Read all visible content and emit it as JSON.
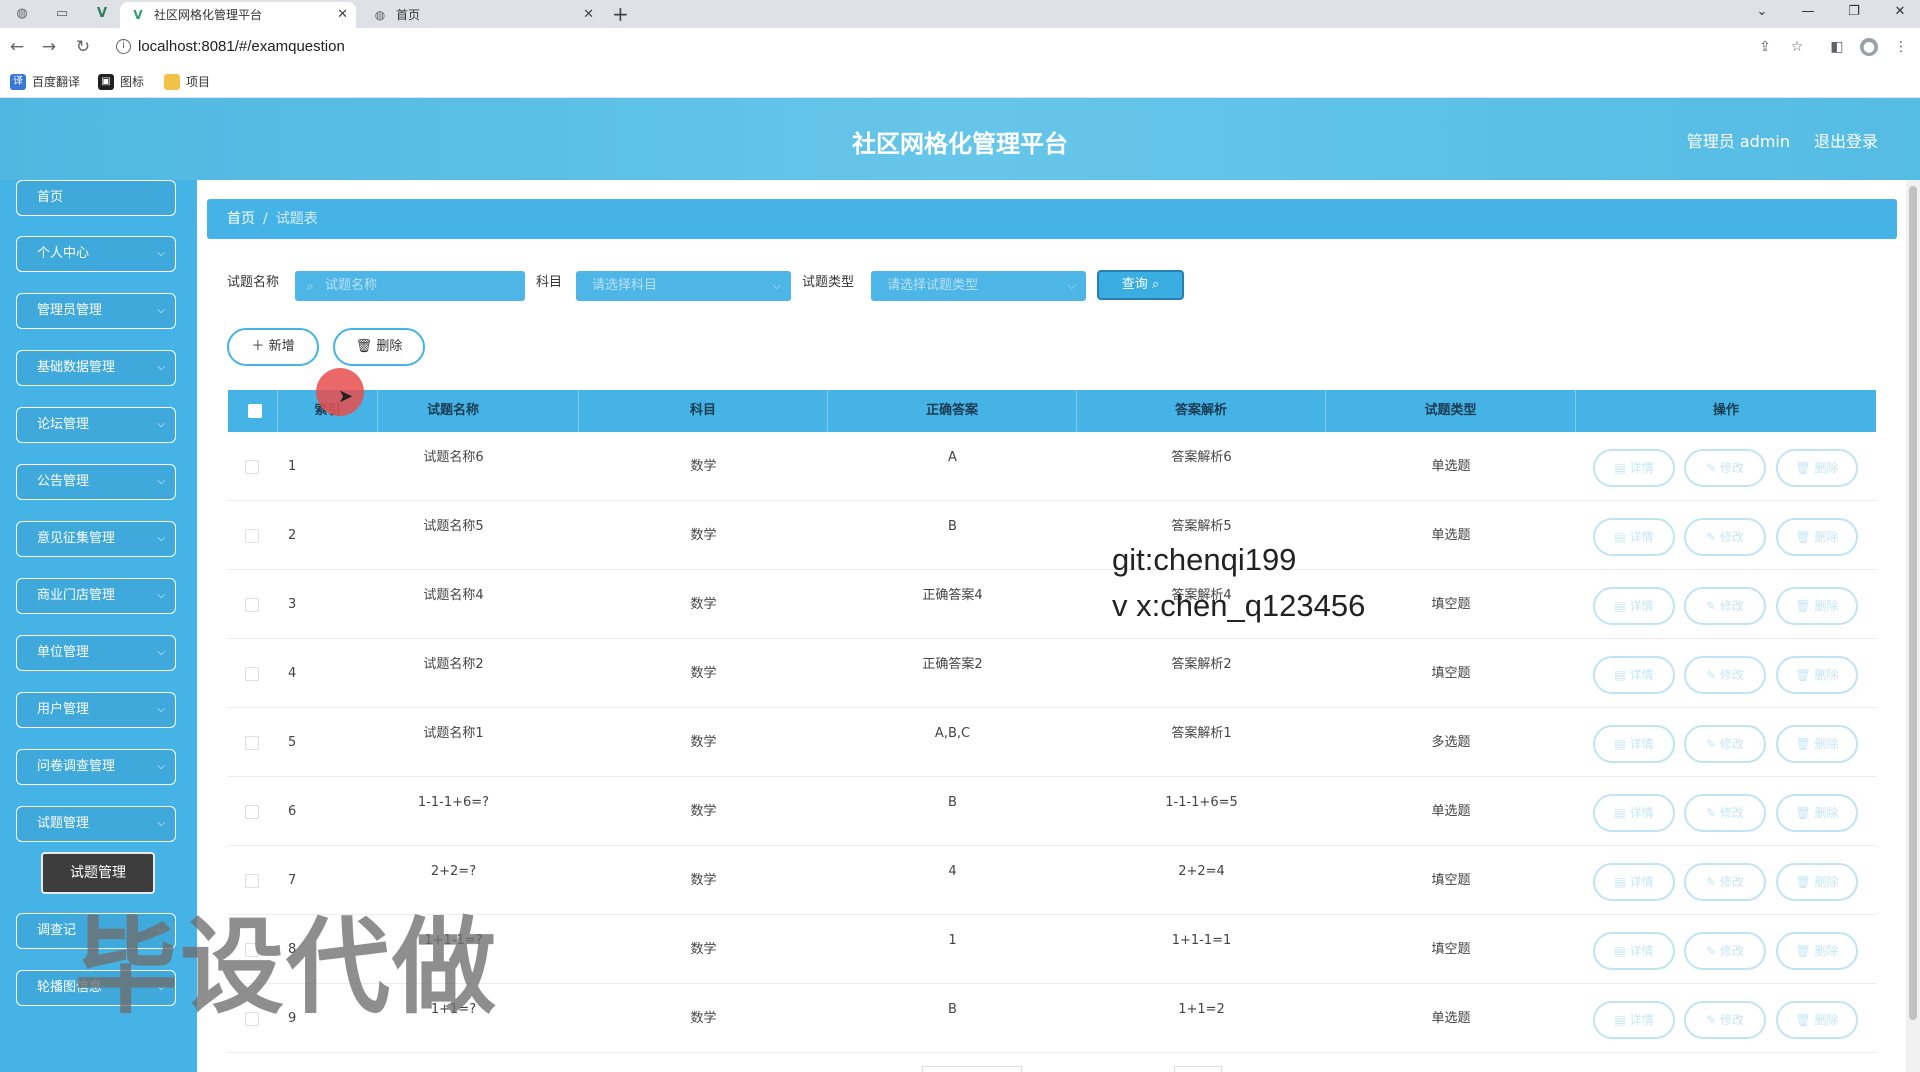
{
  "browser": {
    "tabs": [
      {
        "title": "社区网格化管理平台",
        "active": true
      },
      {
        "title": "首页",
        "active": false
      }
    ],
    "url": "localhost:8081/#/examquestion",
    "bookmarks": [
      "百度翻译",
      "图标",
      "项目"
    ]
  },
  "header": {
    "title": "社区网格化管理平台",
    "user": "管理员 admin",
    "logout": "退出登录"
  },
  "sidebar": {
    "items": [
      {
        "label": "首页",
        "expandable": false
      },
      {
        "label": "个人中心",
        "expandable": true
      },
      {
        "label": "管理员管理",
        "expandable": true
      },
      {
        "label": "基础数据管理",
        "expandable": true
      },
      {
        "label": "论坛管理",
        "expandable": true
      },
      {
        "label": "公告管理",
        "expandable": true
      },
      {
        "label": "意见征集管理",
        "expandable": true
      },
      {
        "label": "商业门店管理",
        "expandable": true
      },
      {
        "label": "单位管理",
        "expandable": true
      },
      {
        "label": "用户管理",
        "expandable": true
      },
      {
        "label": "问卷调查管理",
        "expandable": true
      },
      {
        "label": "试题管理",
        "expandable": true
      },
      {
        "label": "调查记",
        "expandable": true
      },
      {
        "label": "轮播图信息",
        "expandable": true
      }
    ],
    "submenu": "试题管理"
  },
  "breadcrumb": {
    "home": "首页",
    "current": "试题表"
  },
  "search": {
    "name_label": "试题名称",
    "name_placeholder": "试题名称",
    "subject_label": "科目",
    "subject_placeholder": "请选择科目",
    "type_label": "试题类型",
    "type_placeholder": "请选择试题类型",
    "query": "查询"
  },
  "actions": {
    "add": "新增",
    "delete": "删除"
  },
  "table": {
    "columns": [
      "索引",
      "试题名称",
      "科目",
      "正确答案",
      "答案解析",
      "试题类型",
      "操作"
    ],
    "row_actions": {
      "detail": "详情",
      "edit": "修改",
      "delete": "删除"
    },
    "rows": [
      {
        "index": "1",
        "name": "试题名称6",
        "subject": "数学",
        "answer": "A",
        "analysis": "答案解析6",
        "type": "单选题"
      },
      {
        "index": "2",
        "name": "试题名称5",
        "subject": "数学",
        "answer": "B",
        "analysis": "答案解析5",
        "type": "单选题"
      },
      {
        "index": "3",
        "name": "试题名称4",
        "subject": "数学",
        "answer": "正确答案4",
        "analysis": "答案解析4",
        "type": "填空题"
      },
      {
        "index": "4",
        "name": "试题名称2",
        "subject": "数学",
        "answer": "正确答案2",
        "analysis": "答案解析2",
        "type": "填空题"
      },
      {
        "index": "5",
        "name": "试题名称1",
        "subject": "数学",
        "answer": "A,B,C",
        "analysis": "答案解析1",
        "type": "多选题"
      },
      {
        "index": "6",
        "name": "1-1-1+6=?",
        "subject": "数学",
        "answer": "B",
        "analysis": "1-1-1+6=5",
        "type": "单选题"
      },
      {
        "index": "7",
        "name": "2+2=?",
        "subject": "数学",
        "answer": "4",
        "analysis": "2+2=4",
        "type": "填空题"
      },
      {
        "index": "8",
        "name": "1+1-1=?",
        "subject": "数学",
        "answer": "1",
        "analysis": "1+1-1=1",
        "type": "填空题"
      },
      {
        "index": "9",
        "name": "1+1=?",
        "subject": "数学",
        "answer": "B",
        "analysis": "1+1=2",
        "type": "单选题"
      }
    ]
  },
  "watermarks": {
    "line1": "git:chenqi199",
    "line2": "v x:chen_q123456",
    "big": "毕设代做"
  },
  "icons": {
    "search": "search-icon",
    "plus": "plus-icon",
    "trash": "trash-icon",
    "detail": "document-icon",
    "edit": "pencil-icon",
    "chevron": "chevron-down-icon"
  },
  "colors": {
    "primary": "#45b3e5",
    "header": "#5cc0e6",
    "dark_tooltip": "#3d3d3d"
  }
}
